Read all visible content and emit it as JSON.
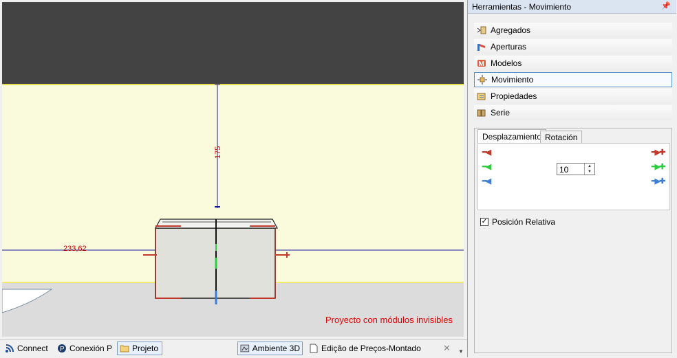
{
  "viewport": {
    "dim_vertical": "175",
    "dim_horizontal": "233,62",
    "status_message": "Proyecto con módulos invisibles"
  },
  "bottom_tabs": [
    {
      "label": "Connect",
      "icon": "rss-icon"
    },
    {
      "label": "Conexión P",
      "icon": "connection-icon"
    },
    {
      "label": "Projeto",
      "icon": "folder-icon"
    },
    {
      "label": "Ambiente 3D",
      "icon": "3d-scene-icon"
    },
    {
      "label": "Edição de Preços-Montado",
      "icon": "document-icon"
    }
  ],
  "panel": {
    "title": "Herramientas - Movimiento",
    "tools": [
      {
        "label": "Agregados",
        "icon": "aggregates-icon"
      },
      {
        "label": "Aperturas",
        "icon": "openings-icon"
      },
      {
        "label": "Modelos",
        "icon": "models-icon"
      },
      {
        "label": "Movimiento",
        "icon": "move-icon"
      },
      {
        "label": "Propiedades",
        "icon": "properties-icon"
      },
      {
        "label": "Serie",
        "icon": "series-icon"
      }
    ],
    "tabs": [
      "Desplazamiento",
      "Rotación"
    ],
    "step_value": "10",
    "relative_label": "Posición Relativa",
    "relative_checked": true
  },
  "colors": {
    "x_axis": "#c0392b",
    "y_axis": "#2ecc40",
    "z_axis": "#3a7fd5",
    "dimension": "#1a1a9c",
    "dimension_text": "#c00000"
  }
}
